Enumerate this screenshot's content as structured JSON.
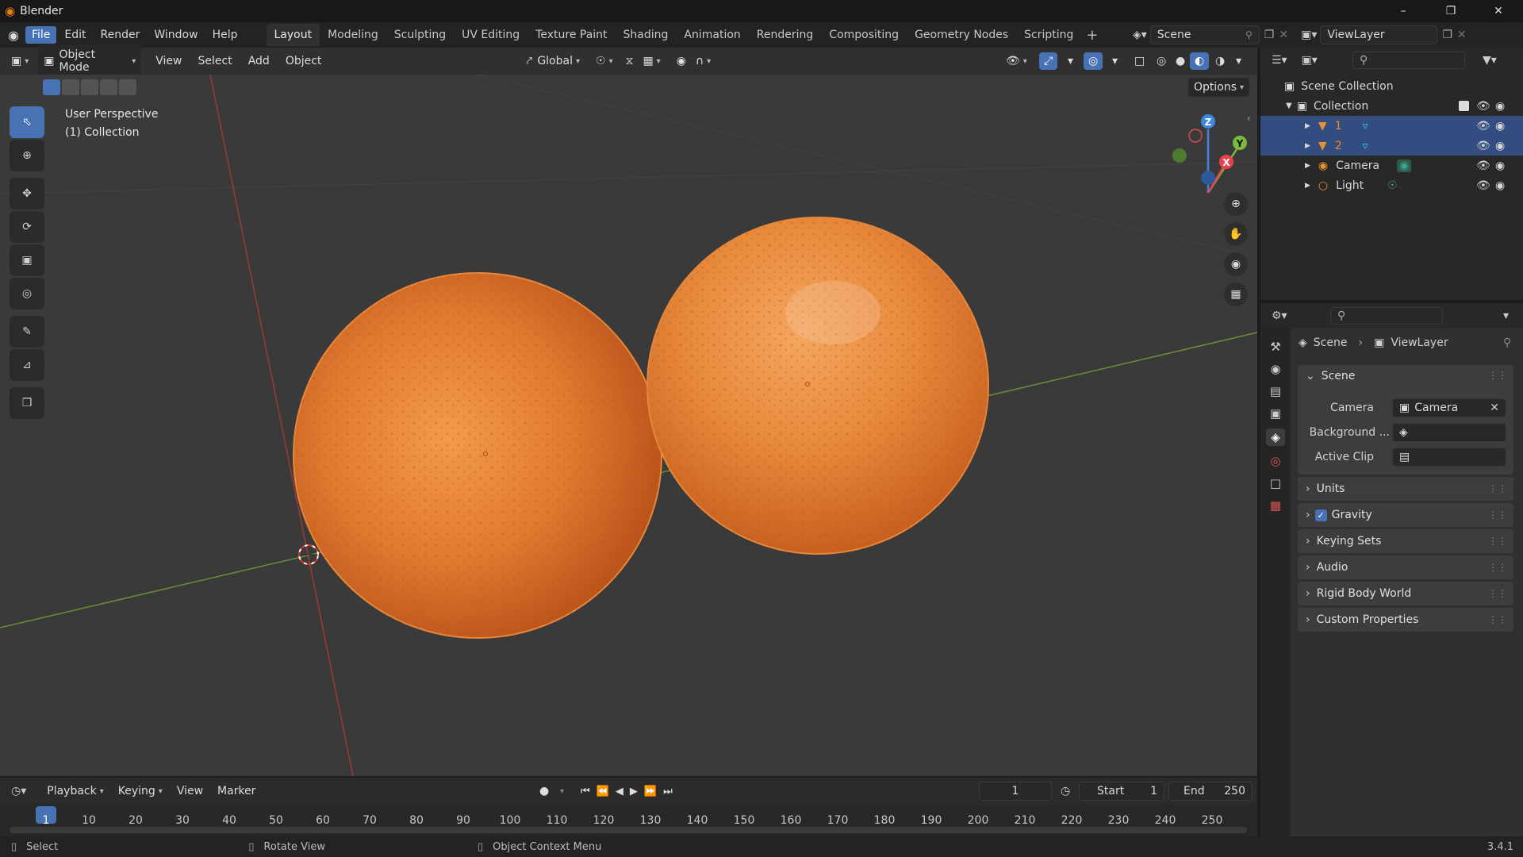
{
  "window": {
    "title": "Blender",
    "version": "3.4.1"
  },
  "menu": [
    "File",
    "Edit",
    "Render",
    "Window",
    "Help"
  ],
  "workspaces": [
    "Layout",
    "Modeling",
    "Sculpting",
    "UV Editing",
    "Texture Paint",
    "Shading",
    "Animation",
    "Rendering",
    "Compositing",
    "Geometry Nodes",
    "Scripting"
  ],
  "scene_field": "Scene",
  "viewlayer_field": "ViewLayer",
  "viewport_header": {
    "mode": "Object Mode",
    "menus": [
      "View",
      "Select",
      "Add",
      "Object"
    ],
    "orientation": "Global",
    "options": "Options"
  },
  "viewport": {
    "perspective_label": "User Perspective",
    "collection_label": "(1) Collection",
    "axis_labels": {
      "z": "Z",
      "y": "Y",
      "x": "X"
    }
  },
  "outliner": {
    "root": "Scene Collection",
    "collection": "Collection",
    "items": [
      {
        "name": "1",
        "type": "mesh"
      },
      {
        "name": "2",
        "type": "mesh"
      },
      {
        "name": "Camera",
        "type": "camera"
      },
      {
        "name": "Light",
        "type": "light"
      }
    ]
  },
  "properties": {
    "breadcrumb": [
      "Scene",
      "ViewLayer"
    ],
    "scene_panel": {
      "title": "Scene",
      "camera_label": "Camera",
      "camera_value": "Camera",
      "background_label": "Background ...",
      "active_clip_label": "Active Clip"
    },
    "panels": [
      "Units",
      "Gravity",
      "Keying Sets",
      "Audio",
      "Rigid Body World",
      "Custom Properties"
    ],
    "gravity_checked": true
  },
  "timeline": {
    "menus": [
      "Playback",
      "Keying",
      "View",
      "Marker"
    ],
    "current_frame": "1",
    "start_label": "Start",
    "start": "1",
    "end_label": "End",
    "end": "250",
    "ticks": [
      "1",
      "10",
      "20",
      "30",
      "40",
      "50",
      "60",
      "70",
      "80",
      "90",
      "100",
      "110",
      "120",
      "130",
      "140",
      "150",
      "160",
      "170",
      "180",
      "190",
      "200",
      "210",
      "220",
      "230",
      "240",
      "250"
    ]
  },
  "statusbar": {
    "select": "Select",
    "rotate": "Rotate View",
    "context": "Object Context Menu"
  },
  "colors": {
    "accent": "#4772b3",
    "orange": "#e0782c",
    "x_axis": "#e8414b",
    "y_axis": "#7ab93c",
    "z_axis": "#3f86e0"
  }
}
